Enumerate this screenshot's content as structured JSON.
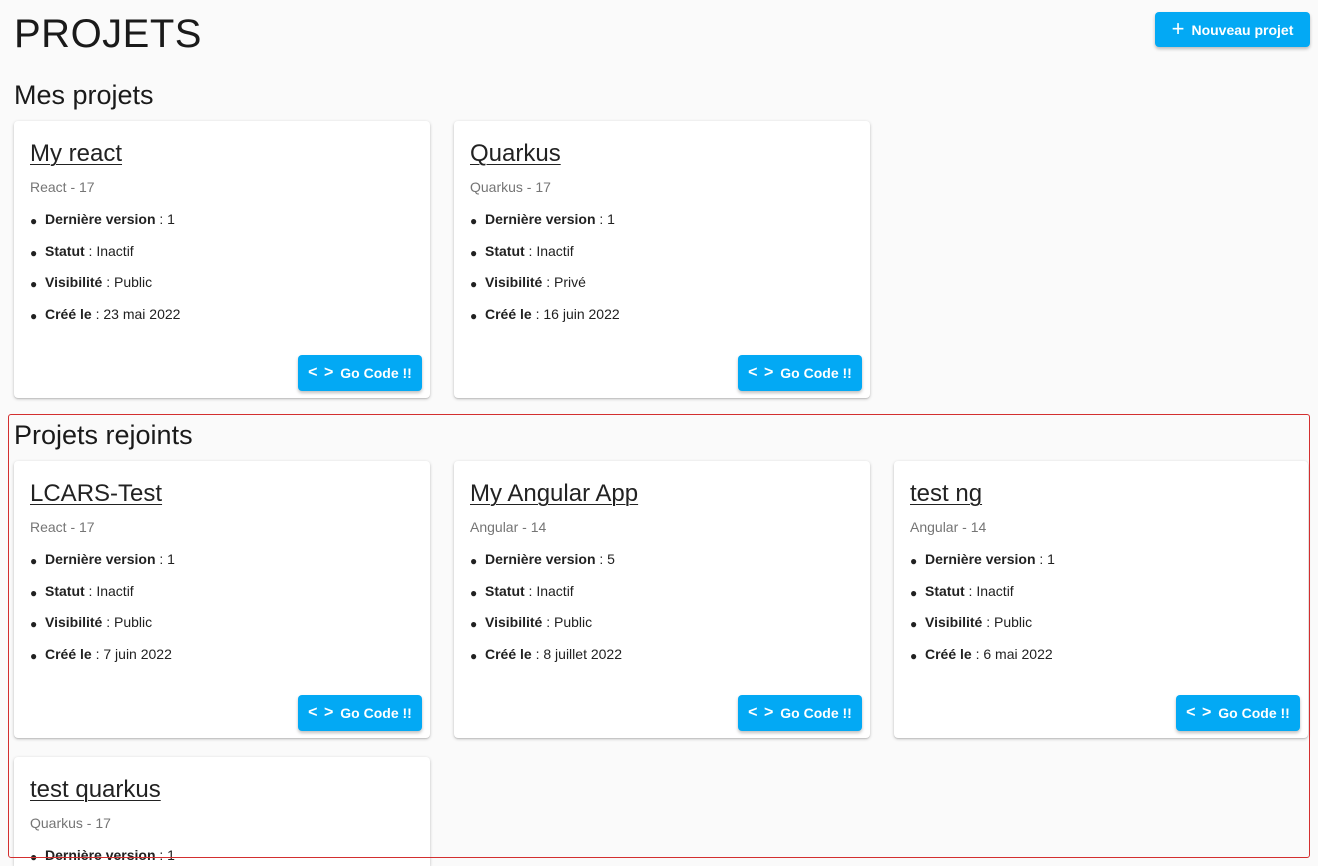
{
  "page": {
    "title": "PROJETS",
    "new_project_label": "Nouveau projet",
    "new_project_icon": "plus-icon"
  },
  "labels": {
    "last_version": "Dernière version",
    "status": "Statut",
    "visibility": "Visibilité",
    "created": "Créé le",
    "separator": " : ",
    "go_code": "Go Code !!",
    "go_code_icon": "code-icon"
  },
  "colors": {
    "accent": "#03a9f4",
    "highlight_border": "#d32f2f"
  },
  "my_projects": {
    "title": "Mes projets",
    "items": [
      {
        "name": "My react",
        "subtitle": "React - 17",
        "last_version": "1",
        "status": "Inactif",
        "visibility": "Public",
        "created": "23 mai 2022"
      },
      {
        "name": "Quarkus",
        "subtitle": "Quarkus - 17",
        "last_version": "1",
        "status": "Inactif",
        "visibility": "Privé",
        "created": "16 juin 2022"
      }
    ]
  },
  "joined_projects": {
    "title": "Projets rejoints",
    "items": [
      {
        "name": "LCARS-Test",
        "subtitle": "React - 17",
        "last_version": "1",
        "status": "Inactif",
        "visibility": "Public",
        "created": "7 juin 2022"
      },
      {
        "name": "My Angular App",
        "subtitle": "Angular - 14",
        "last_version": "5",
        "status": "Inactif",
        "visibility": "Public",
        "created": "8 juillet 2022"
      },
      {
        "name": "test ng",
        "subtitle": "Angular - 14",
        "last_version": "1",
        "status": "Inactif",
        "visibility": "Public",
        "created": "6 mai 2022"
      },
      {
        "name": "test quarkus",
        "subtitle": "Quarkus - 17",
        "last_version": "1",
        "status": "",
        "visibility": "",
        "created": ""
      }
    ]
  }
}
